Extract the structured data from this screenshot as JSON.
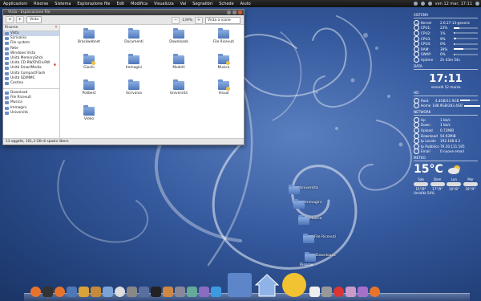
{
  "top_panel": {
    "menus": [
      "Applicazioni",
      "Risorse",
      "Sistema",
      "Esplorazione file",
      "Edit",
      "Modifica",
      "Visualizza",
      "Vai",
      "Segnalibri",
      "Schede",
      "Aiuto"
    ],
    "clock": "ven 12 mar, 17:11"
  },
  "file_manager": {
    "title": "Vista - Esplorazione file",
    "path_button": "Vista",
    "zoom": "139%",
    "view_mode": "Vista a icone",
    "sidebar_header": "Risorse",
    "sidebar_items": [
      {
        "label": "Vista",
        "selected": true
      },
      {
        "label": "Scrivania"
      },
      {
        "label": "File system"
      },
      {
        "label": "Rete"
      },
      {
        "label": "Windows Vista"
      },
      {
        "label": "Unità MemoryStick"
      },
      {
        "label": "Unità CD-RW/DVD±RW",
        "eject": true
      },
      {
        "label": "Unità SmartMedia"
      },
      {
        "label": "Unità CompactFlash"
      },
      {
        "label": "Unità SD/MMC"
      },
      {
        "label": "Cestino"
      }
    ],
    "bookmarks": [
      "Download",
      "File Ricevuti",
      "Musica",
      "Immagini",
      "Università"
    ],
    "files": [
      {
        "label": "Brasilwebnet"
      },
      {
        "label": "Documenti"
      },
      {
        "label": "Downloads"
      },
      {
        "label": "File Ricevuti"
      },
      {
        "label": "Giochi",
        "emblem": true
      },
      {
        "label": "Immagini"
      },
      {
        "label": "Modelli"
      },
      {
        "label": "Musica",
        "emblem": true
      },
      {
        "label": "Polibest"
      },
      {
        "label": "Scrivania"
      },
      {
        "label": "Università"
      },
      {
        "label": "Visual",
        "emblem": true
      },
      {
        "label": "Video"
      }
    ],
    "status": "13 oggetti, 101,3 GB di spazio libero"
  },
  "conky": {
    "system_header": "SISTEMA",
    "system": [
      {
        "label": "Kernel",
        "value": "2.6.27-13-generic",
        "pct": null
      },
      {
        "label": "CPU1:",
        "value": "23%",
        "pct": 23
      },
      {
        "label": "CPU2:",
        "value": "1%",
        "pct": 1
      },
      {
        "label": "CPU3:",
        "value": "9%",
        "pct": 9
      },
      {
        "label": "CPU4:",
        "value": "0%",
        "pct": 0
      },
      {
        "label": "RAM:",
        "value": "39%",
        "pct": 39
      },
      {
        "label": "SWAP:",
        "value": "0%",
        "pct": 0
      },
      {
        "label": "Uptime",
        "value": "2h 43m 54s",
        "pct": null
      }
    ],
    "date_header": "DATA",
    "time": "17:11",
    "date": "venerdì 12 marzo",
    "hd_header": "HD",
    "hd": [
      {
        "label": "Root",
        "value": "4.4GB/11.9GB",
        "pct": 37
      },
      {
        "label": "Home",
        "value": "188.9GB/283.4GB",
        "pct": 66
      }
    ],
    "net_header": "NETWORK",
    "net": [
      {
        "label": "Up",
        "value": "1 kb/s"
      },
      {
        "label": "Down",
        "value": "1 kb/s"
      },
      {
        "label": "Upload",
        "value": "0.72MiB"
      },
      {
        "label": "Download",
        "value": "54.93MiB"
      },
      {
        "label": "Ip Locale",
        "value": "192.168.0.2"
      },
      {
        "label": "Ip Pubblico",
        "value": "79.20.111.185"
      },
      {
        "label": "Email",
        "value": "0 nuove email"
      }
    ],
    "meteo_header": "METEO",
    "temperature": "15°C",
    "forecast": [
      {
        "day": "Sab",
        "temp": "15°/9°"
      },
      {
        "day": "Dom",
        "temp": "17°/9°"
      },
      {
        "day": "Lun",
        "temp": "18°/8°"
      },
      {
        "day": "Mar",
        "temp": "18°/9°"
      }
    ],
    "humidity": "Umidità 54%"
  },
  "desktop_icons": [
    {
      "label": "Università"
    },
    {
      "label": "Immagini"
    },
    {
      "label": "Musica"
    },
    {
      "label": "File Ricevuti"
    },
    {
      "label": "Downloads"
    },
    {
      "label": "Risorse"
    }
  ],
  "dock_icons": [
    "firefox-icon",
    "terminal-icon",
    "firefox-icon",
    "thunderbird-icon",
    "package-icon",
    "archive-icon",
    "recycle-icon",
    "clock-icon",
    "settings-icon",
    "anchor-icon",
    "tux-icon",
    "game-icon",
    "screenshot-icon",
    "chat-icon",
    "pidgin-icon",
    "skype-icon",
    "separator",
    "window-icon",
    "home-icon",
    "weather-icon",
    "calendar-icon",
    "trash-icon",
    "power-icon",
    "burn-icon",
    "music-icon",
    "firefox-icon"
  ],
  "colors": {
    "accent": "#3a5fa6",
    "panel": "#1a1a1a",
    "folder": "#5b86c8"
  }
}
